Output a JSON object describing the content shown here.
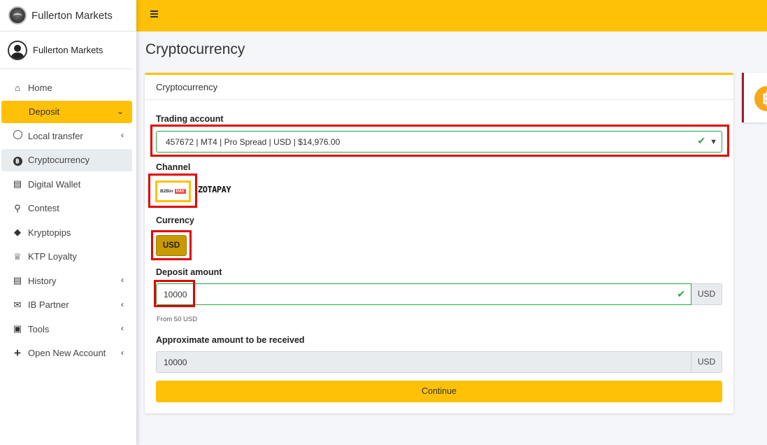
{
  "brand": {
    "name": "Fullerton Markets"
  },
  "user": {
    "name": "Fullerton Markets"
  },
  "sidebar": {
    "items": [
      {
        "label": "Home"
      },
      {
        "label": "Deposit"
      },
      {
        "label": "Local transfer"
      },
      {
        "label": "Cryptocurrency"
      },
      {
        "label": "Digital Wallet"
      },
      {
        "label": "Contest"
      },
      {
        "label": "Kryptopips"
      },
      {
        "label": "KTP Loyalty"
      },
      {
        "label": "History"
      },
      {
        "label": "IB Partner"
      },
      {
        "label": "Tools"
      },
      {
        "label": "Open New Account"
      }
    ]
  },
  "page": {
    "title": "Cryptocurrency"
  },
  "card": {
    "title": "Cryptocurrency"
  },
  "form": {
    "trading_account_label": "Trading account",
    "trading_account_value": "457672 | MT4 | Pro Spread | USD | $14,976.00",
    "channel_label": "Channel",
    "channels": [
      {
        "name": "B2Bin",
        "badge": "PAY"
      },
      {
        "name": "ZOTAPAY"
      }
    ],
    "currency_label": "Currency",
    "currency_value": "USD",
    "deposit_label": "Deposit amount",
    "deposit_value": "10000",
    "deposit_unit": "USD",
    "deposit_hint": "From 50 USD",
    "approx_label": "Approximate amount to be received",
    "approx_value": "10000",
    "approx_unit": "USD",
    "continue_label": "Continue"
  },
  "colors": {
    "accent": "#ffc107",
    "valid": "#28a745",
    "highlight": "#e30000",
    "bitcoin": "#f7a81b"
  },
  "icons": {
    "bitcoin": "bitcoin-icon"
  }
}
